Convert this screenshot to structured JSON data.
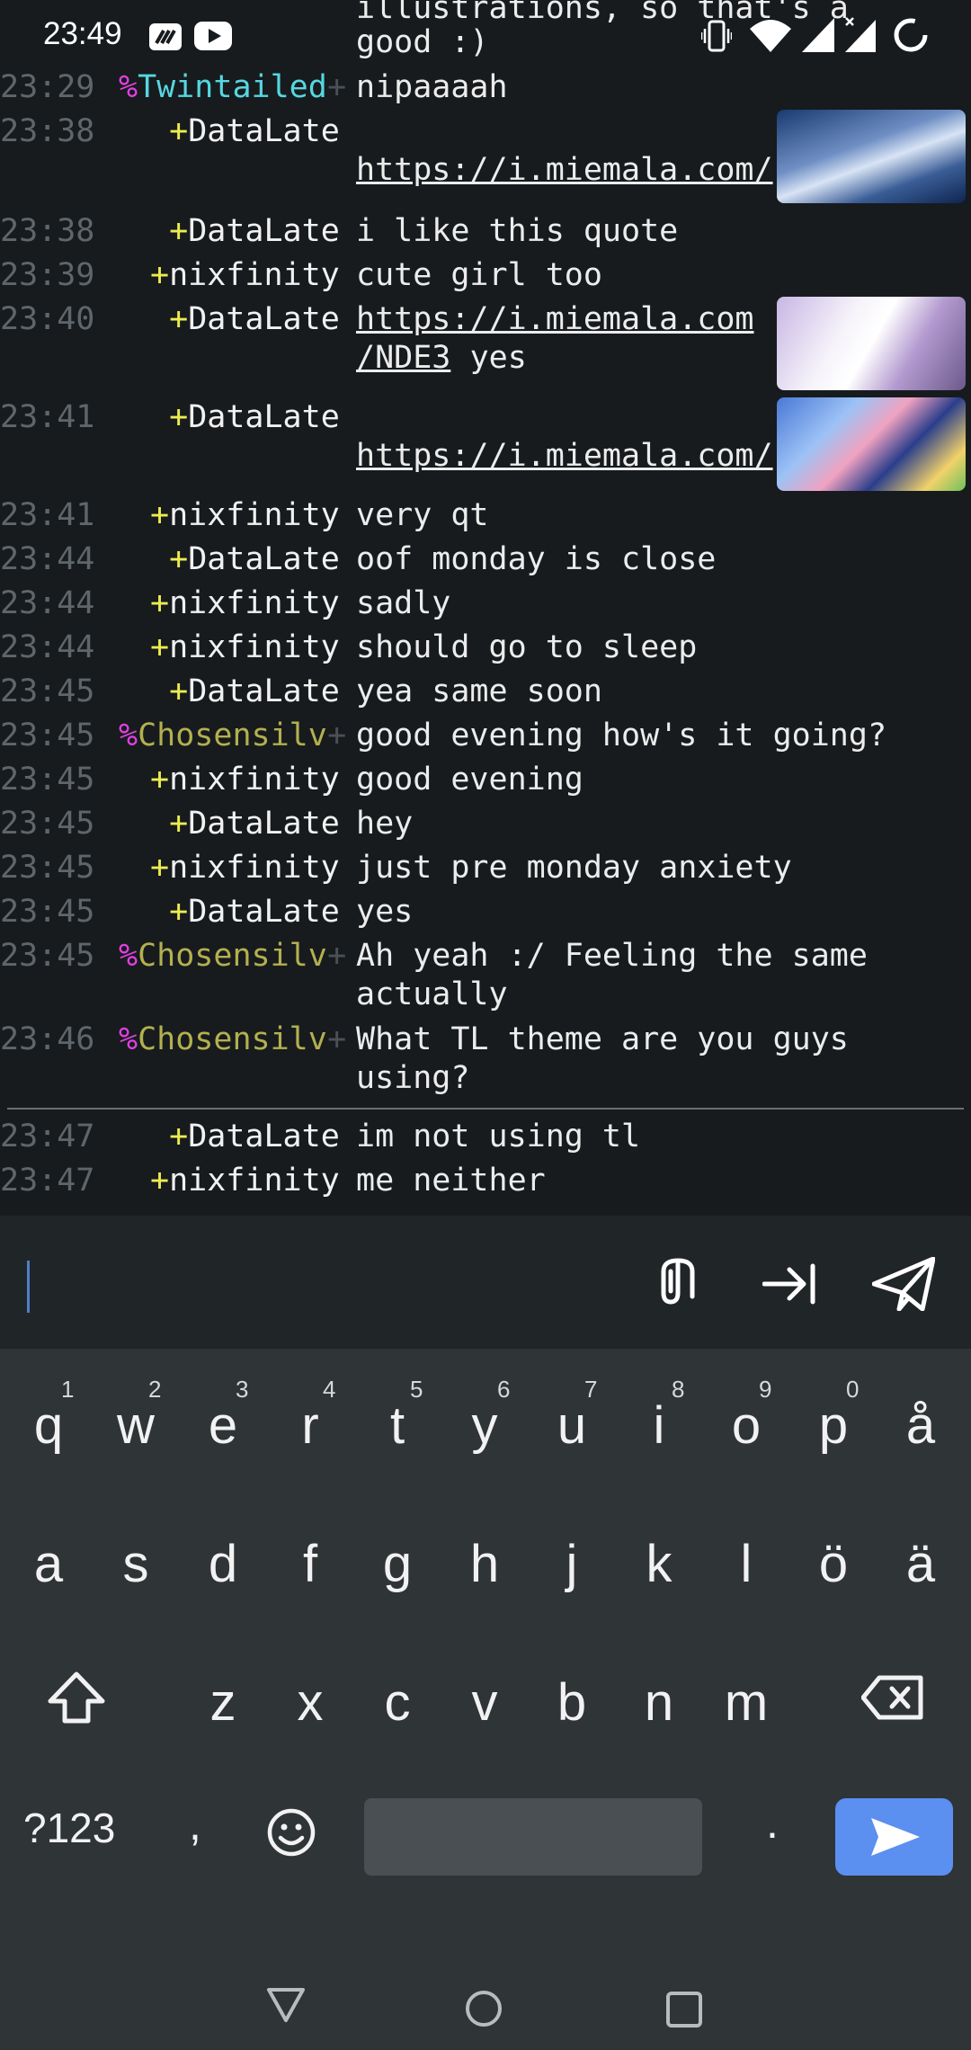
{
  "status_bar": {
    "time": "23:49",
    "icons": [
      "tidal-icon",
      "youtube-icon",
      "vibrate-icon",
      "wifi-icon",
      "signal-icon",
      "signal-nodata-icon",
      "loading-icon"
    ]
  },
  "chat": {
    "partial_top": [
      "illustrations, so that's a",
      "good :)"
    ],
    "lines": [
      {
        "time": "23:29",
        "prefix": "%",
        "nick": "Twintailed",
        "more": "+",
        "msg": "nipaaaah"
      },
      {
        "time": "23:38",
        "prefix": "+",
        "nick": "DataLate",
        "msg": "",
        "msg2": "https://i.miemala.com/",
        "thumb": "anime-thumbnail-1"
      },
      {
        "time": "23:38",
        "prefix": "+",
        "nick": "DataLate",
        "msg": "i like this quote"
      },
      {
        "time": "23:39",
        "prefix": "+",
        "nick": "nixfinity",
        "msg": "cute girl too"
      },
      {
        "time": "23:40",
        "prefix": "+",
        "nick": "DataLate",
        "msg": "https://i.miemala.com",
        "msg2a": "/NDE3",
        "msg2b": " yes",
        "thumb": "anime-thumbnail-2"
      },
      {
        "time": "23:41",
        "prefix": "+",
        "nick": "DataLate",
        "msg": "",
        "msg2": "https://i.miemala.com/",
        "thumb": "anime-thumbnail-3"
      },
      {
        "time": "23:41",
        "prefix": "+",
        "nick": "nixfinity",
        "msg": "very qt"
      },
      {
        "time": "23:44",
        "prefix": "+",
        "nick": "DataLate",
        "msg": "oof monday is close"
      },
      {
        "time": "23:44",
        "prefix": "+",
        "nick": "nixfinity",
        "msg": "sadly"
      },
      {
        "time": "23:44",
        "prefix": "+",
        "nick": "nixfinity",
        "msg": "should go to sleep"
      },
      {
        "time": "23:45",
        "prefix": "+",
        "nick": "DataLate",
        "msg": "yea same soon"
      },
      {
        "time": "23:45",
        "prefix": "%",
        "nick": "Chosensilv",
        "more": "+",
        "msg": "good evening how's it going?"
      },
      {
        "time": "23:45",
        "prefix": "+",
        "nick": "nixfinity",
        "msg": "good evening"
      },
      {
        "time": "23:45",
        "prefix": "+",
        "nick": "DataLate",
        "msg": "hey"
      },
      {
        "time": "23:45",
        "prefix": "+",
        "nick": "nixfinity",
        "msg": "just pre monday anxiety"
      },
      {
        "time": "23:45",
        "prefix": "+",
        "nick": "DataLate",
        "msg": "yes"
      },
      {
        "time": "23:45",
        "prefix": "%",
        "nick": "Chosensilv",
        "more": "+",
        "msg": "Ah yeah :/ Feeling the same",
        "msg2": "actually"
      },
      {
        "time": "23:46",
        "prefix": "%",
        "nick": "Chosensilv",
        "more": "+",
        "msg": "What TL theme are you guys",
        "msg2": "using?"
      },
      {
        "time": "23:47",
        "prefix": "+",
        "nick": "DataLate",
        "msg": "im not using tl"
      },
      {
        "time": "23:47",
        "prefix": "+",
        "nick": "nixfinity",
        "msg": "me neither"
      }
    ]
  },
  "input_bar": {
    "value": "",
    "icons": [
      "attach-icon",
      "tab-complete-icon",
      "send-icon"
    ]
  },
  "keyboard": {
    "row1": [
      {
        "k": "q",
        "h": "1"
      },
      {
        "k": "w",
        "h": "2"
      },
      {
        "k": "e",
        "h": "3"
      },
      {
        "k": "r",
        "h": "4"
      },
      {
        "k": "t",
        "h": "5"
      },
      {
        "k": "y",
        "h": "6"
      },
      {
        "k": "u",
        "h": "7"
      },
      {
        "k": "i",
        "h": "8"
      },
      {
        "k": "o",
        "h": "9"
      },
      {
        "k": "p",
        "h": "0"
      },
      {
        "k": "å",
        "h": ""
      }
    ],
    "row2": [
      "a",
      "s",
      "d",
      "f",
      "g",
      "h",
      "j",
      "k",
      "l",
      "ö",
      "ä"
    ],
    "row3": [
      "z",
      "x",
      "c",
      "v",
      "b",
      "n",
      "m"
    ],
    "symbols_label": "?123",
    "comma": ",",
    "period": "."
  },
  "nav_bar": {
    "icons": [
      "back-icon",
      "home-icon",
      "recents-icon"
    ]
  }
}
